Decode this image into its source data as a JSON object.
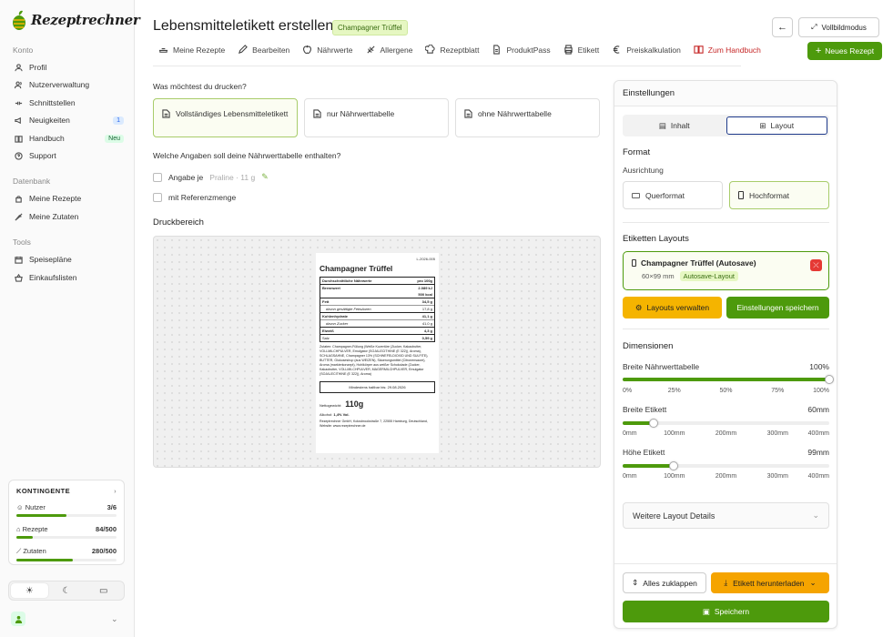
{
  "brand": {
    "name": "Rezeptrechner",
    "green": "#4d9a0c",
    "orange": "#f5b400"
  },
  "sidebar": {
    "sections": [
      {
        "title": "Konto",
        "items": [
          {
            "label": "Profil",
            "icon": "user-icon"
          },
          {
            "label": "Nutzerverwaltung",
            "icon": "users-icon"
          },
          {
            "label": "Schnittstellen",
            "icon": "api-icon"
          },
          {
            "label": "Neuigkeiten",
            "icon": "megaphone-icon",
            "badge": "1"
          },
          {
            "label": "Handbuch",
            "icon": "book-icon",
            "badge": "Neu"
          },
          {
            "label": "Support",
            "icon": "help-icon"
          }
        ]
      },
      {
        "title": "Datenbank",
        "items": [
          {
            "label": "Meine Rezepte",
            "icon": "recipe-icon"
          },
          {
            "label": "Meine Zutaten",
            "icon": "carrot-icon"
          }
        ]
      },
      {
        "title": "Tools",
        "items": [
          {
            "label": "Speisepläne",
            "icon": "calendar-icon"
          },
          {
            "label": "Einkaufslisten",
            "icon": "basket-icon"
          }
        ]
      }
    ],
    "quota": {
      "title": "KONTINGENTE",
      "rows": [
        {
          "label": "Nutzer",
          "value": "3/6",
          "fraction": 0.5
        },
        {
          "label": "Rezepte",
          "value": "84/500",
          "fraction": 0.168
        },
        {
          "label": "Zutaten",
          "value": "280/500",
          "fraction": 0.56
        }
      ]
    },
    "theme": [
      "☀",
      "☾",
      "▭"
    ]
  },
  "header": {
    "title": "Lebensmitteletikett erstellen",
    "tag": "Champagner Trüffel",
    "fullscreen": "Vollbildmodus",
    "back_icon": "←"
  },
  "tabs": [
    {
      "label": "Meine Rezepte"
    },
    {
      "label": "Bearbeiten"
    },
    {
      "label": "Nährwerte"
    },
    {
      "label": "Allergene"
    },
    {
      "label": "Rezeptblatt"
    },
    {
      "label": "ProduktPass"
    },
    {
      "label": "Etikett"
    },
    {
      "label": "Preiskalkulation"
    },
    {
      "label": "Zum Handbuch"
    }
  ],
  "new_recipe": "Neues Rezept",
  "print_question": "Was möchtest du drucken?",
  "print_options": [
    "Vollständiges Lebensmitteletikett",
    "nur Nährwerttabelle",
    "ohne Nährwerttabelle"
  ],
  "nutrition_question": "Welche Angaben soll deine Nährwerttabelle enthalten?",
  "checks": {
    "per_label": "Angabe je",
    "per_hint": "Praline · 11 g",
    "ref_label": "mit Referenzmenge"
  },
  "print_area": "Druckbereich",
  "label": {
    "id": "L-2026-005",
    "name": "Champagner Trüffel",
    "nutr_head": [
      "Durchschnittliche Nährwerte",
      "pro 100g"
    ],
    "nutr_rows": [
      [
        "Brennwert",
        "2.089 kJ"
      ],
      [
        "",
        "500 kcal"
      ],
      [
        "Fett",
        "34,5 g"
      ],
      [
        "davon gesättigte Fettsäuren",
        "17,8 g"
      ],
      [
        "Kohlenhydrate",
        "41,1 g"
      ],
      [
        "davon Zucker",
        "41,0 g"
      ],
      [
        "Eiweiß",
        "4,3 g"
      ],
      [
        "Salz",
        "0,59 g"
      ]
    ],
    "ingredients": "Zutaten: Champagner-Füllung (Weiße Kuvertüre (Zucker, Kakaobutter, VOLLMILCHPULVER, Emulgator (SOJALECITHINE (E 322)), Aroma), SCHLAGSAHNE, Champagner 13% (SCHWEFELDIOXID UND SULFITE), BUTTER, Glukosesirup (aus WEIZEN), Säuerungsmittel (Citronensaure), Aroma (markierkonzept), Hohlkörper aus weißer Schokolade (Zucker, Kakaobutter, VOLLMILCHPULVER, MAGERMILCHPULVER, Emulgator (SOJALECITHINE (E 322)), Aroma)",
    "mhd_label": "Mindestens haltbar bis:",
    "mhd_date": "29.08.2026",
    "net_label": "Nettogewicht:",
    "net_value": "110g",
    "alc_label": "Alkohol:",
    "alc_value": "1,4% Vol.",
    "manufacturer": "Rezeptrechner GmbH, Kolosbrookstraße 7, 22555 Hamburg, Deutschland, Website: www.rezeptrechner.de"
  },
  "panel": {
    "title": "Einstellungen",
    "tab_content": "Inhalt",
    "tab_layout": "Layout",
    "format": "Format",
    "orientation": "Ausrichtung",
    "landscape": "Querformat",
    "portrait": "Hochformat",
    "layouts_title": "Etiketten Layouts",
    "layout_name": "Champagner Trüffel (Autosave)",
    "layout_size": "60×99 mm",
    "layout_tag": "Autosave-Layout",
    "manage": "Layouts verwalten",
    "save_settings": "Einstellungen speichern",
    "dims": "Dimensionen",
    "sliders": [
      {
        "label": "Breite Nährwerttabelle",
        "value": "100%",
        "fraction": 1.0,
        "ticks": [
          "0%",
          "25%",
          "50%",
          "75%",
          "100%"
        ]
      },
      {
        "label": "Breite Etikett",
        "value": "60mm",
        "fraction": 0.15,
        "ticks": [
          "0mm",
          "100mm",
          "200mm",
          "300mm",
          "400mm"
        ]
      },
      {
        "label": "Höhe Etikett",
        "value": "99mm",
        "fraction": 0.2475,
        "ticks": [
          "0mm",
          "100mm",
          "200mm",
          "300mm",
          "400mm"
        ]
      }
    ],
    "more": "Weitere Layout Details",
    "collapse": "Alles zuklappen",
    "download": "Etikett herunterladen",
    "save": "Speichern"
  }
}
